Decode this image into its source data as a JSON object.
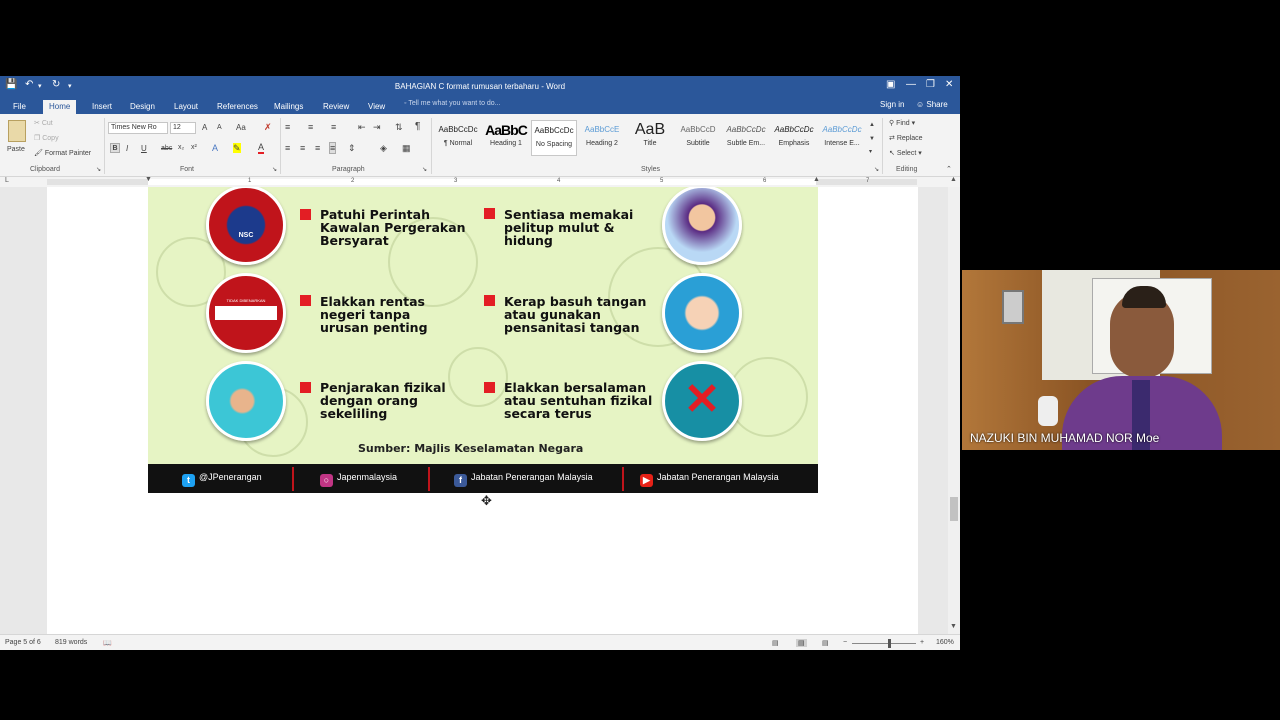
{
  "window": {
    "title": "BAHAGIAN C format rumusan terbaharu - Word",
    "controls": [
      "restore-ribbon",
      "minimize",
      "restore",
      "close"
    ]
  },
  "menu": {
    "tabs": [
      "File",
      "Home",
      "Insert",
      "Design",
      "Layout",
      "References",
      "Mailings",
      "Review",
      "View"
    ],
    "active_tab": "Home",
    "tell_me": "Tell me what you want to do...",
    "sign_in": "Sign in",
    "share": "Share"
  },
  "ribbon": {
    "clipboard": {
      "paste": "Paste",
      "cut": "Cut",
      "copy": "Copy",
      "format_painter": "Format Painter",
      "label": "Clipboard"
    },
    "font": {
      "name": "Times New Ro",
      "size": "12",
      "label": "Font",
      "bold": "B",
      "italic": "I",
      "underline": "U",
      "strike": "abc",
      "subscript": "x₂",
      "superscript": "x²",
      "grow": "A",
      "shrink": "A",
      "case": "Aa",
      "font_color": "A"
    },
    "paragraph": {
      "label": "Paragraph",
      "pilcrow": "¶"
    },
    "styles": {
      "label": "Styles",
      "items": [
        {
          "preview": "AaBbCcDc",
          "name": "¶ Normal"
        },
        {
          "preview": "AaBbC",
          "name": "Heading 1"
        },
        {
          "preview": "AaBbCcDc",
          "name": "No Spacing"
        },
        {
          "preview": "AaBbCcE",
          "name": "Heading 2"
        },
        {
          "preview": "AaB",
          "name": "Title"
        },
        {
          "preview": "AaBbCcD",
          "name": "Subtitle"
        },
        {
          "preview": "AaBbCcDc",
          "name": "Subtle Em..."
        },
        {
          "preview": "AaBbCcDc",
          "name": "Emphasis"
        },
        {
          "preview": "AaBbCcDc",
          "name": "Intense E..."
        }
      ],
      "selected": "No Spacing"
    },
    "editing": {
      "label": "Editing",
      "find": "Find",
      "replace": "Replace",
      "select": "Select"
    }
  },
  "ruler": {
    "numbers": [
      "1",
      "2",
      "3",
      "4",
      "5",
      "6",
      "7"
    ]
  },
  "poster": {
    "items": [
      {
        "text_lines": [
          "Patuhi Perintah",
          "Kawalan Pergerakan",
          "Bersyarat"
        ]
      },
      {
        "text_lines": [
          "Sentiasa memakai",
          "pelitup mulut &",
          "hidung"
        ]
      },
      {
        "text_lines": [
          "Elakkan rentas",
          "negeri tanpa",
          "urusan penting"
        ]
      },
      {
        "text_lines": [
          "Kerap basuh tangan",
          "atau gunakan",
          "pensanitasi tangan"
        ]
      },
      {
        "text_lines": [
          "Penjarakan fizikal",
          "dengan orang",
          "sekeliling"
        ]
      },
      {
        "text_lines": [
          "Elakkan bersalaman",
          "atau sentuhan fizikal",
          "secara terus"
        ]
      }
    ],
    "badge_text": "NSC",
    "sign_text": "TIDAK DIBENARKAN",
    "source": "Sumber: Majlis Keselamatan Negara",
    "social": [
      {
        "platform": "twitter",
        "label": "@JPenerangan",
        "color": "#1da1f2"
      },
      {
        "platform": "instagram",
        "label": "Japenmalaysia",
        "color": "#c13584"
      },
      {
        "platform": "facebook",
        "label": "Jabatan Penerangan Malaysia",
        "color": "#3b5998"
      },
      {
        "platform": "youtube",
        "label": "Jabatan Penerangan Malaysia",
        "color": "#e62117"
      }
    ]
  },
  "status": {
    "page": "Page 5 of 6",
    "words": "819 words",
    "zoom": "160%"
  },
  "webcam": {
    "name": "NAZUKI BIN MUHAMAD NOR Moe"
  }
}
